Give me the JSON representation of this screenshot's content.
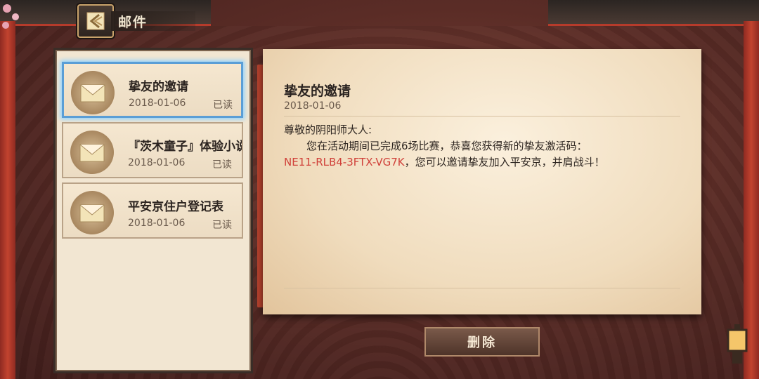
{
  "header": {
    "title": "邮件",
    "back_icon": "back-arrow-icon"
  },
  "mail_list": [
    {
      "title": "挚友的邀请",
      "date": "2018-01-06",
      "status": "已读",
      "selected": true
    },
    {
      "title": "『茨木童子』体验小说",
      "date": "2018-01-06",
      "status": "已读",
      "selected": false
    },
    {
      "title": "平安京住户登记表",
      "date": "2018-01-06",
      "status": "已读",
      "selected": false
    }
  ],
  "letter": {
    "title": "挚友的邀请",
    "date": "2018-01-06",
    "greeting": "尊敬的阴阳师大人:",
    "body_before_code": "您在活动期间已完成6场比赛，恭喜您获得新的挚友激活码：",
    "code": "NE11-RLB4-3FTX-VG7K",
    "body_after_code": "，您可以邀请挚友加入平安京，并肩战斗！"
  },
  "actions": {
    "delete_label": "删除"
  },
  "colors": {
    "accent_code": "#d0413a",
    "selected_border": "#5a9ed6"
  }
}
